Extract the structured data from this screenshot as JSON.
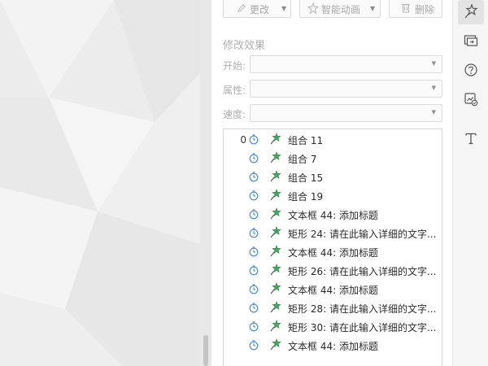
{
  "toolbar": {
    "change_label": "更改",
    "smart_animation_label": "智能动画",
    "delete_label": "删除"
  },
  "effect": {
    "section_title": "修改效果",
    "start_label": "开始:",
    "property_label": "属性:",
    "speed_label": "速度:",
    "start_value": "",
    "property_value": "",
    "speed_value": ""
  },
  "animation_list": [
    {
      "order": "0",
      "label": "组合 11"
    },
    {
      "order": "",
      "label": "组合 7"
    },
    {
      "order": "",
      "label": "组合 15"
    },
    {
      "order": "",
      "label": "组合 19"
    },
    {
      "order": "",
      "label": "文本框 44: 添加标题"
    },
    {
      "order": "",
      "label": "矩形 24: 请在此输入详细的文字..."
    },
    {
      "order": "",
      "label": "文本框 44: 添加标题"
    },
    {
      "order": "",
      "label": "矩形 26: 请在此输入详细的文字..."
    },
    {
      "order": "",
      "label": "文本框 44: 添加标题"
    },
    {
      "order": "",
      "label": "矩形 28: 请在此输入详细的文字..."
    },
    {
      "order": "",
      "label": "矩形 30: 请在此输入详细的文字..."
    },
    {
      "order": "",
      "label": "文本框 44: 添加标题"
    }
  ],
  "sidebar_icons": [
    "custom-animation-icon",
    "slide-transition-icon",
    "help-icon",
    "animation-painter-icon",
    "text-tool-icon"
  ],
  "colors": {
    "clock_blue": "#4a8fd6",
    "pin_green": "#3cab5a",
    "pin_star": "#2f7a3f"
  }
}
